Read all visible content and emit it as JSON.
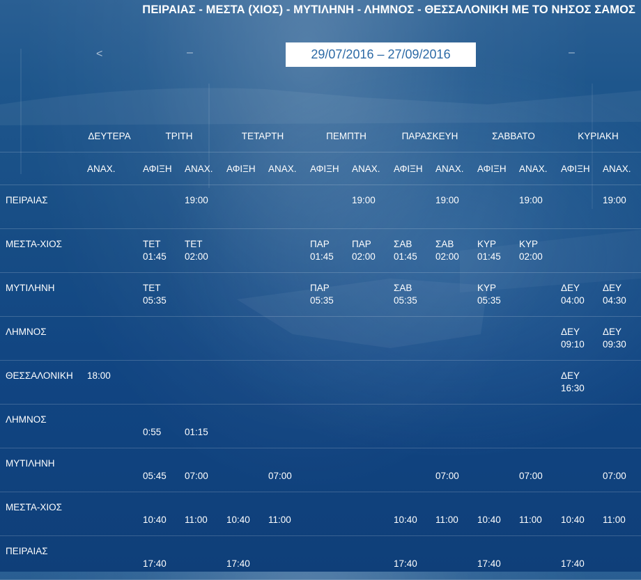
{
  "route_title": "ΠΕΙΡΑΙΑΣ - ΜΕΣΤΑ (ΧΙΟΣ) - ΜΥΤΙΛΗΝΗ - ΛΗΜΝΟΣ - ΘΕΣΣΑΛΟΝΙΚΗ ΜΕ ΤΟ ΝΗΣΟΣ ΣΑΜΟΣ",
  "date_range": "29/07/2016 – 27/09/2016",
  "nav": {
    "prev": "<",
    "sep1": "–",
    "sep2": "–"
  },
  "days": [
    "ΔΕΥΤΕΡΑ",
    "ΤΡΙΤΗ",
    "ΤΕΤΑΡΤΗ",
    "ΠΕΜΠΤΗ",
    "ΠΑΡΑΣΚΕΥΗ",
    "ΣΑΒΒΑΤΟ",
    "ΚΥΡΙΑΚΗ"
  ],
  "column_headers": [
    "ΑΝΑΧ.",
    "ΑΦΙΞΗ",
    "ΑΝΑΧ.",
    "ΑΦΙΞΗ",
    "ΑΝΑΧ.",
    "ΑΦΙΞΗ",
    "ΑΝΑΧ.",
    "ΑΦΙΞΗ",
    "ΑΝΑΧ.",
    "ΑΦΙΞΗ",
    "ΑΝΑΧ.",
    "ΑΦΙΞΗ",
    "ΑΝΑΧ."
  ],
  "rows": [
    {
      "port": "ΠΕΙΡΑΙΑΣ",
      "cells": [
        "",
        "",
        "19:00",
        "",
        "",
        "",
        "19:00",
        "",
        "19:00",
        "",
        "19:00",
        "",
        "19:00"
      ]
    },
    {
      "port": "ΜΕΣΤΑ-ΧΙΟΣ",
      "cells": [
        "",
        "ΤΕΤ\n01:45",
        "ΤΕΤ\n02:00",
        "",
        "",
        "ΠΑΡ\n01:45",
        "ΠΑΡ\n02:00",
        "ΣΑΒ\n01:45",
        "ΣΑΒ\n02:00",
        "ΚΥΡ\n01:45",
        "ΚΥΡ\n02:00",
        "",
        ""
      ]
    },
    {
      "port": "ΜΥΤΙΛΗΝΗ",
      "cells": [
        "",
        "ΤΕΤ\n05:35",
        "",
        "",
        "",
        "ΠΑΡ\n05:35",
        "",
        "ΣΑΒ\n05:35",
        "",
        "ΚΥΡ\n05:35",
        "",
        "ΔΕΥ\n04:00",
        "ΔΕΥ\n04:30"
      ]
    },
    {
      "port": "ΛΗΜΝΟΣ",
      "cells": [
        "",
        "",
        "",
        "",
        "",
        "",
        "",
        "",
        "",
        "",
        "",
        "ΔΕΥ\n09:10",
        "ΔΕΥ\n09:30"
      ]
    },
    {
      "port": "ΘΕΣΣΑΛΟΝΙΚΗ",
      "cells": [
        "18:00",
        "",
        "",
        "",
        "",
        "",
        "",
        "",
        "",
        "",
        "",
        "ΔΕΥ\n16:30",
        ""
      ]
    },
    {
      "port": "ΛΗΜΝΟΣ",
      "cells": [
        "",
        "\n0:55",
        "\n01:15",
        "",
        "",
        "",
        "",
        "",
        "",
        "",
        "",
        "",
        ""
      ]
    },
    {
      "port": "ΜΥΤΙΛΗΝΗ",
      "cells": [
        "",
        "\n05:45",
        "\n07:00",
        "",
        "\n07:00",
        "",
        "",
        "",
        "\n07:00",
        "",
        "\n07:00",
        "",
        "\n07:00"
      ]
    },
    {
      "port": "ΜΕΣΤΑ-ΧΙΟΣ",
      "cells": [
        "",
        "\n10:40",
        "\n11:00",
        "\n10:40",
        "\n11:00",
        "",
        "",
        "\n10:40",
        "\n11:00",
        "\n10:40",
        "\n11:00",
        "\n10:40",
        "\n11:00"
      ]
    },
    {
      "port": "ΠΕΙΡΑΙΑΣ",
      "cells": [
        "",
        "\n17:40",
        "",
        "\n17:40",
        "",
        "",
        "",
        "\n17:40",
        "",
        "\n17:40",
        "",
        "\n17:40",
        ""
      ]
    }
  ]
}
